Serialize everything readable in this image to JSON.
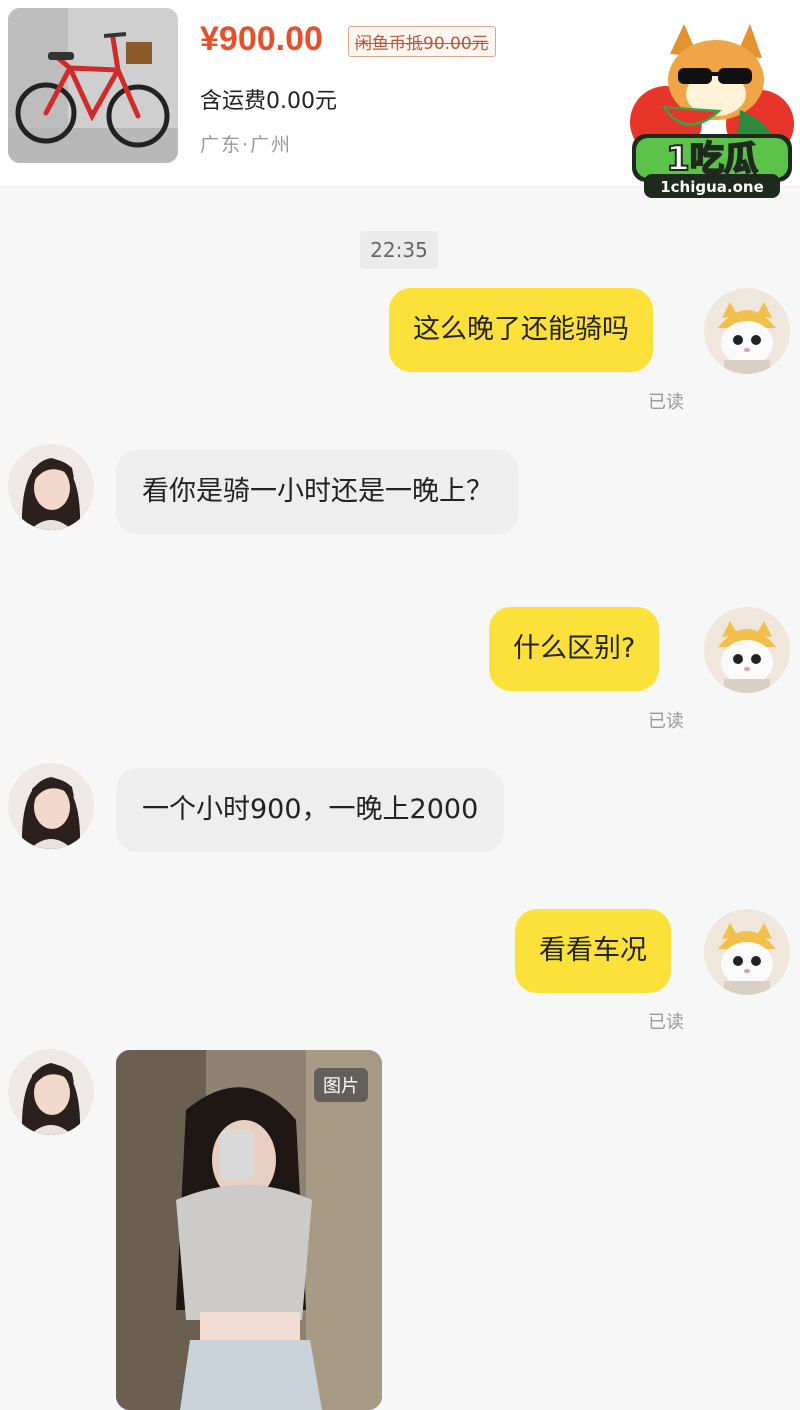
{
  "product": {
    "image": "red-bicycle-photo",
    "price": "¥900.00",
    "price_tag": "闲鱼币抵90.00元",
    "shipping": "含运费0.00元",
    "location": "广东·广州"
  },
  "watermark": {
    "icon": "watermelon-mascot-logo",
    "brand": "1吃瓜",
    "domain": "1chigua.one"
  },
  "chat": {
    "timestamp": "22:35",
    "messages": [
      {
        "side": "out",
        "text": "这么晚了还能骑吗",
        "status": "已读"
      },
      {
        "side": "in",
        "text": "看你是骑一小时还是一晚上？"
      },
      {
        "side": "out",
        "text": "什么区别?",
        "status": "已读"
      },
      {
        "side": "in",
        "text": "一个小时900，一晚上2000"
      },
      {
        "side": "out",
        "text": "看看车况",
        "status": "已读"
      },
      {
        "side": "in",
        "type": "image",
        "label": "图片"
      }
    ]
  },
  "colors": {
    "accent_yellow": "#fde13b",
    "price_red": "#e8502c",
    "incoming_bubble": "#eeeeee"
  }
}
